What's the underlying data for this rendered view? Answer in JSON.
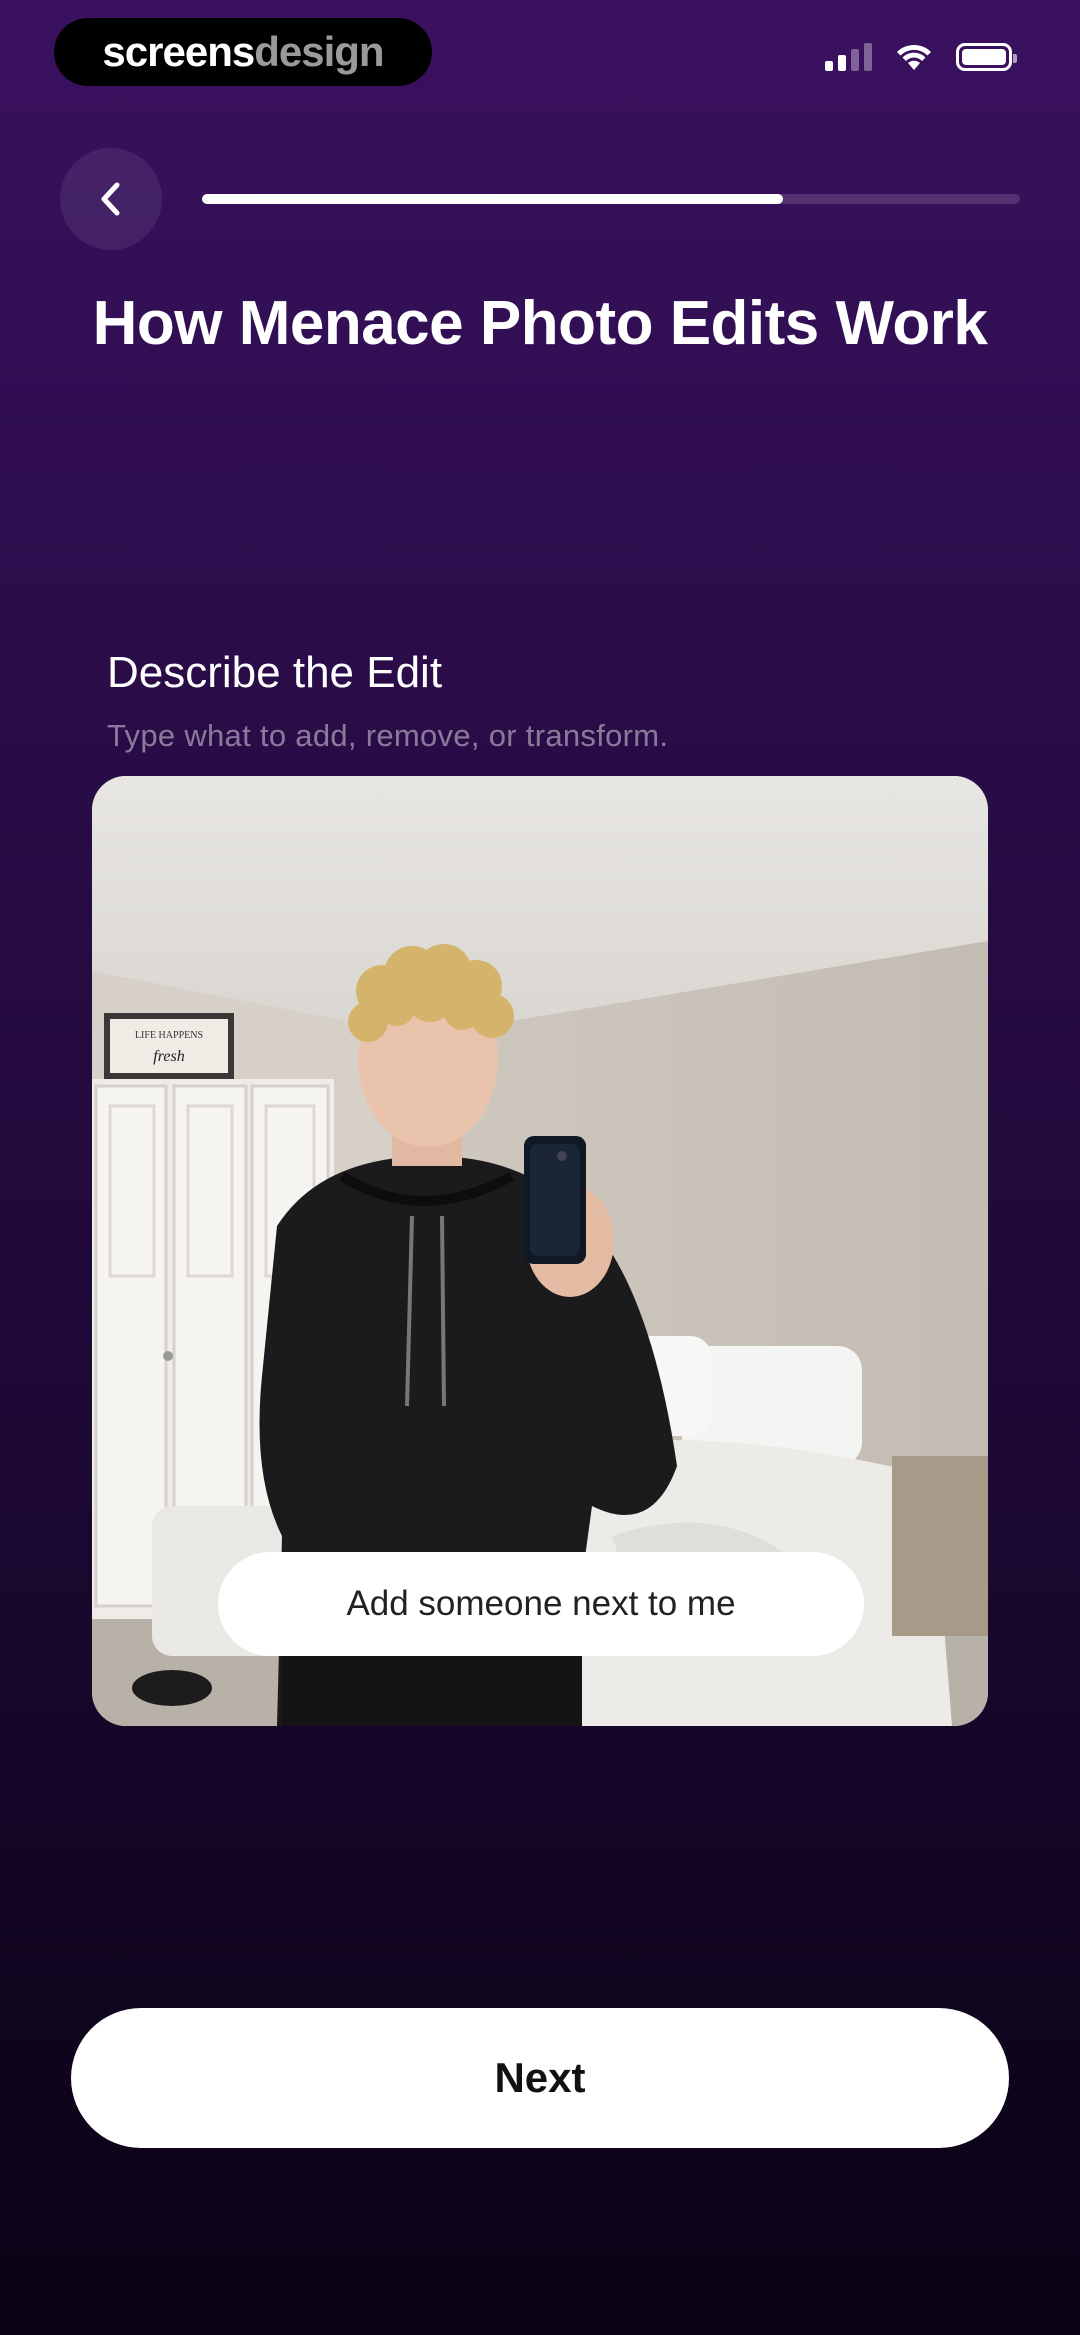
{
  "status_bar": {
    "brand_part1": "screens",
    "brand_part2": "design",
    "icons": [
      "cellular-signal-icon",
      "wifi-icon",
      "battery-icon"
    ]
  },
  "header": {
    "back_icon": "chevron-left-icon",
    "progress": 0.71
  },
  "title": "How Menace Photo Edits Work",
  "step": {
    "title": "Describe the Edit",
    "subtitle": "Type what to add, remove, or transform."
  },
  "photo": {
    "prompt": "Add someone next to me"
  },
  "next_label": "Next",
  "colors": {
    "background_top": "#3a1160",
    "background_bottom": "#0a0315",
    "button": "#ffffff"
  }
}
